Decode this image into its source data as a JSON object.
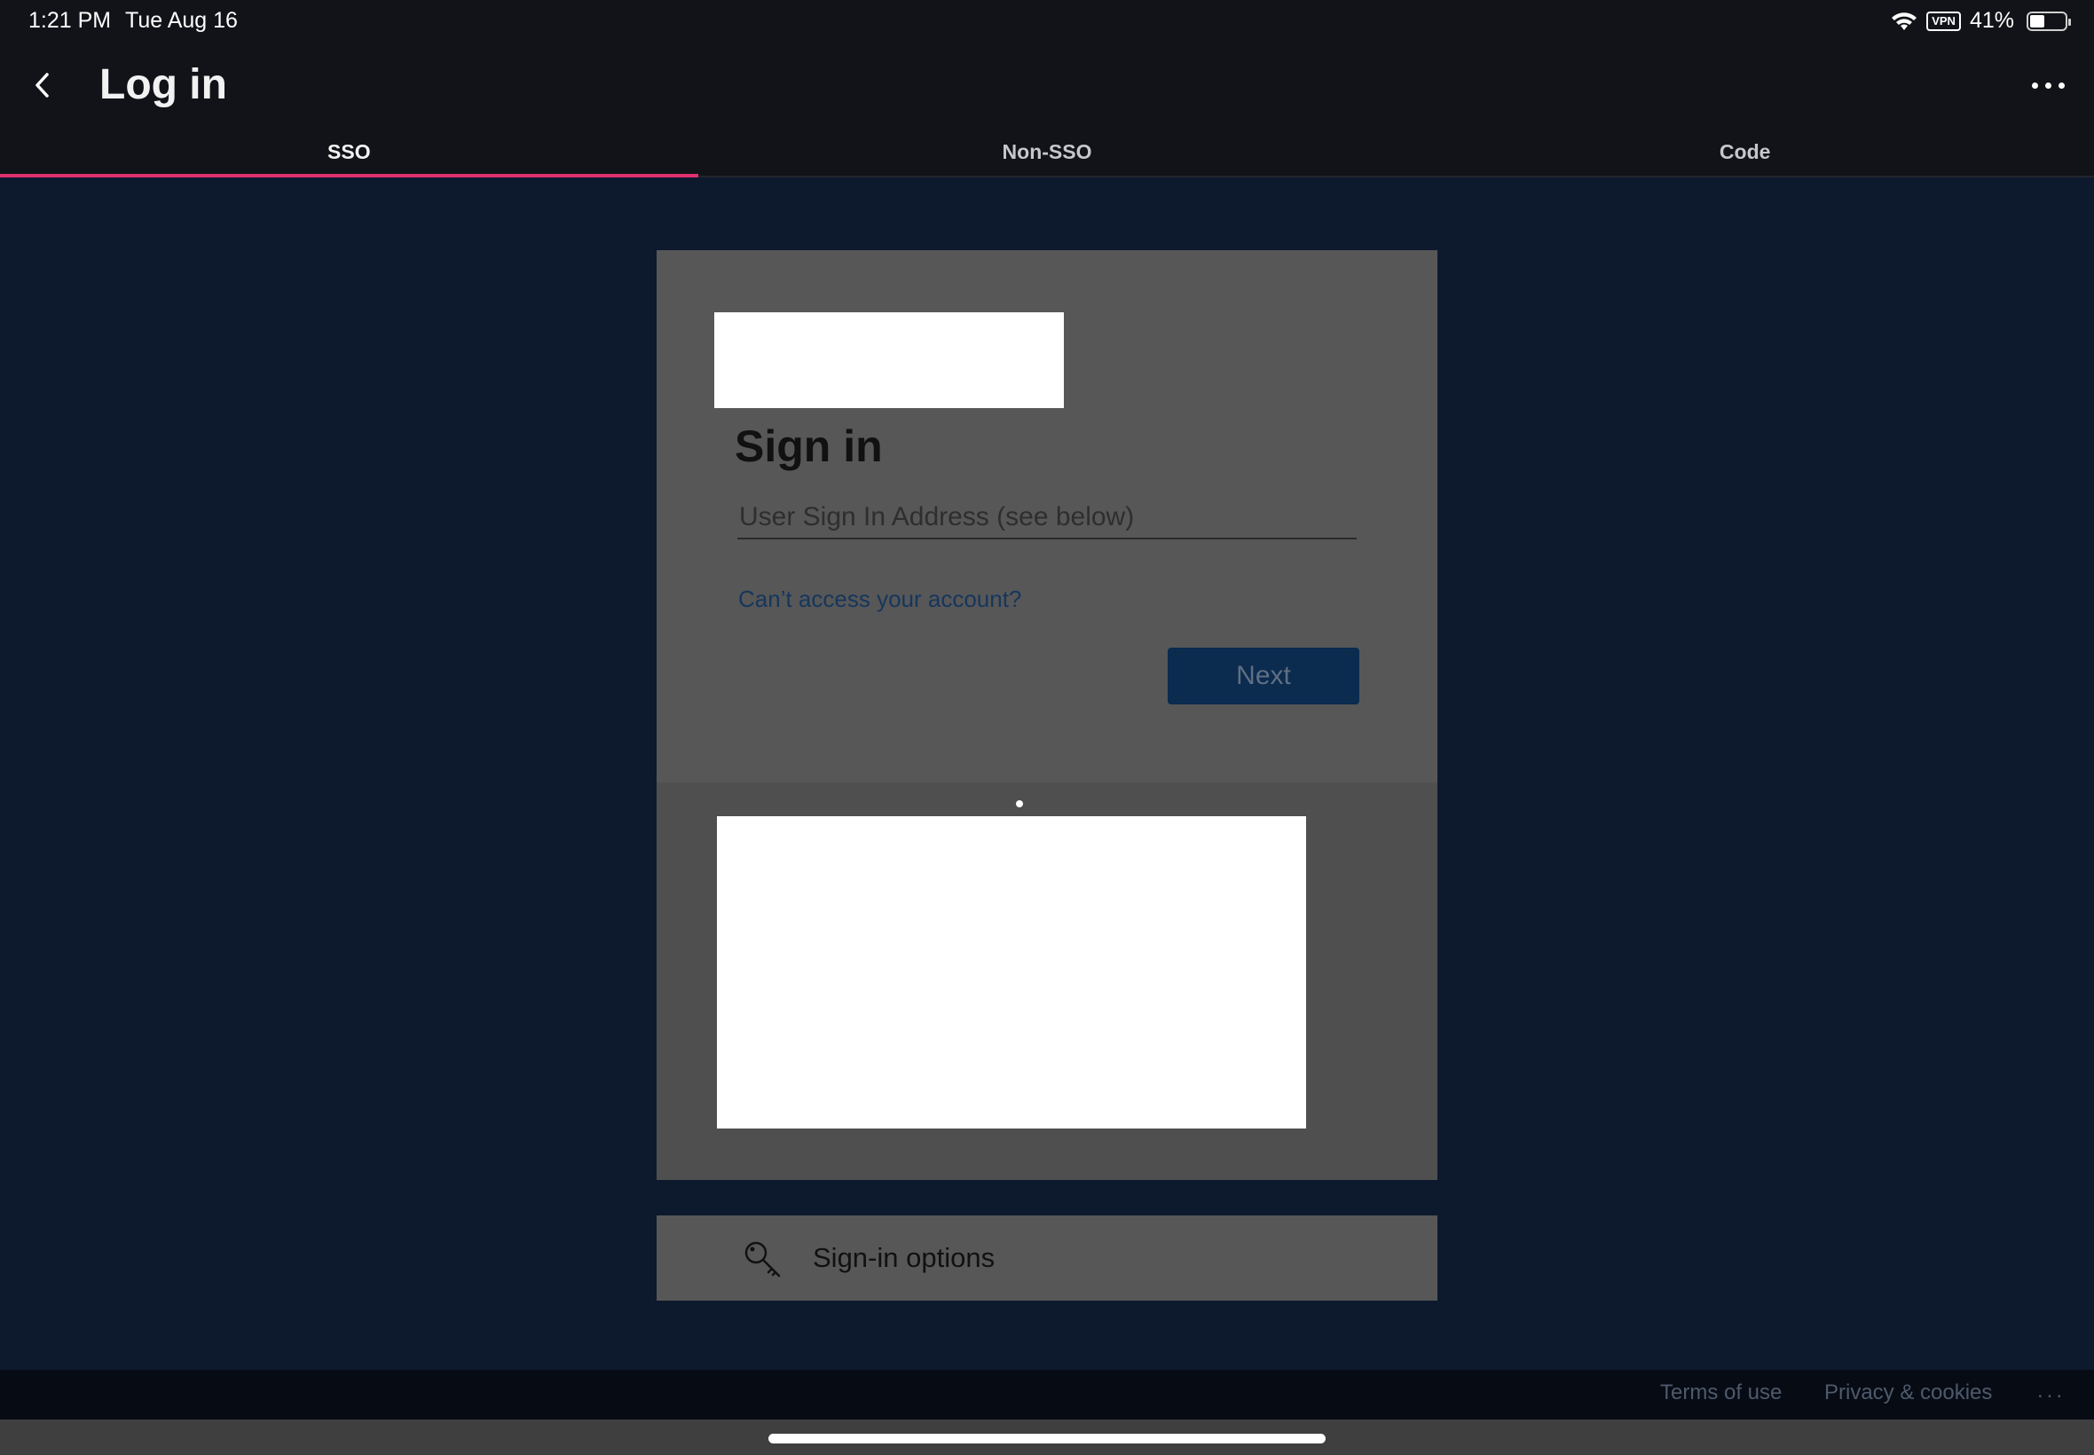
{
  "status_bar": {
    "time": "1:21 PM",
    "date": "Tue Aug 16",
    "vpn": "VPN",
    "battery": "41%",
    "battery_level": 0.41
  },
  "header": {
    "title": "Log in"
  },
  "tabs": [
    {
      "label": "SSO",
      "active": true
    },
    {
      "label": "Non-SSO",
      "active": false
    },
    {
      "label": "Code",
      "active": false
    }
  ],
  "signin": {
    "title": "Sign in",
    "email_placeholder": "User Sign In Address (see below)",
    "email_value": "",
    "cant_access": "Can’t access your account?",
    "next_label": "Next"
  },
  "options": {
    "label": "Sign-in options",
    "icon": "key-icon"
  },
  "footer": {
    "terms": "Terms of use",
    "privacy": "Privacy & cookies",
    "more": "..."
  },
  "colors": {
    "background": "#0d1a2e",
    "header": "#111318",
    "tab_indicator": "#e0306e",
    "card": "#575757",
    "next_button": "#0b2b4f",
    "link": "#16365c"
  }
}
